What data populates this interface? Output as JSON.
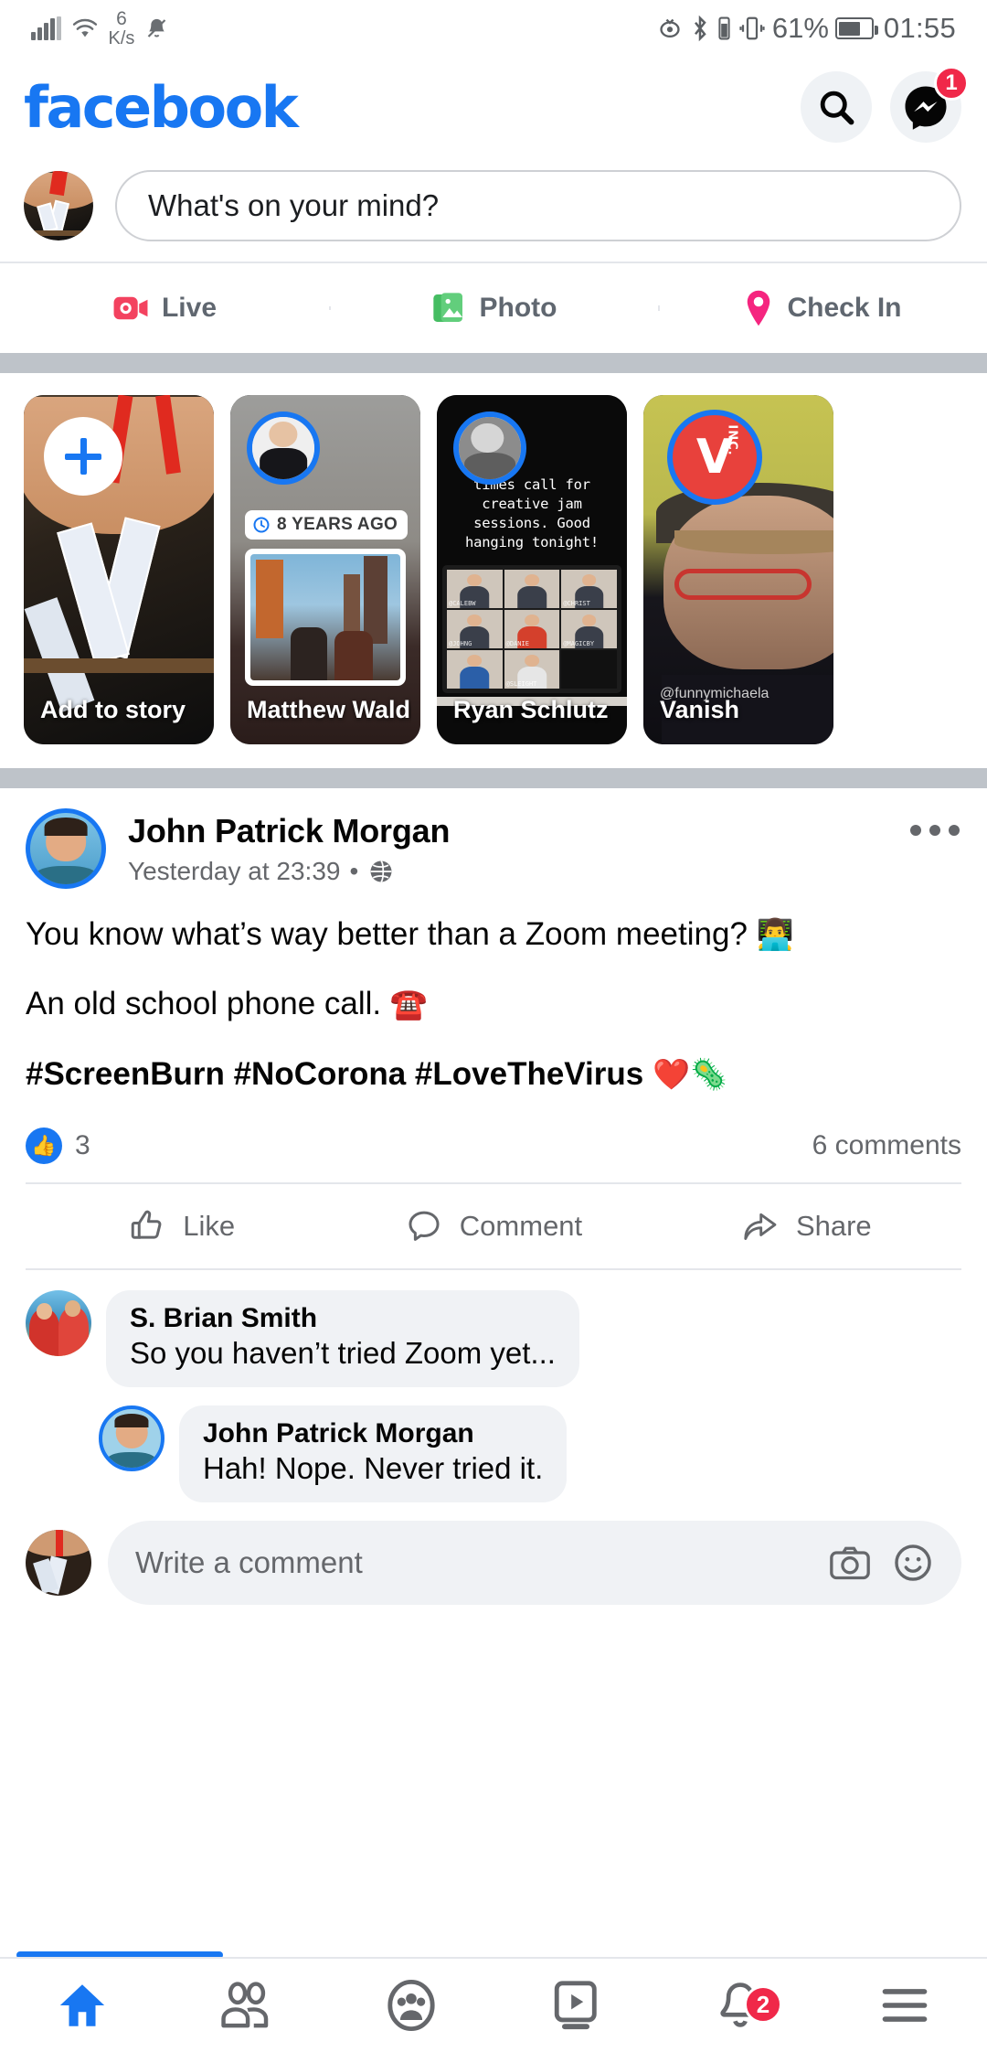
{
  "status_bar": {
    "network_speed_value": "6",
    "network_speed_unit": "K/s",
    "battery_percent": "61%",
    "time": "01:55",
    "icons": [
      "signal-bars-icon",
      "wifi-icon",
      "notification-silenced-icon",
      "eye-care-icon",
      "bluetooth-icon",
      "vibrate-icon",
      "battery-icon"
    ]
  },
  "header": {
    "logo_text": "facebook",
    "search_label": "Search",
    "messenger_label": "Messenger",
    "messenger_badge": "1"
  },
  "composer": {
    "placeholder": "What's on your mind?",
    "avatar_name": "user-avatar"
  },
  "composer_actions": [
    {
      "label": "Live",
      "color": "#F3425F",
      "icon": "live-video-icon"
    },
    {
      "label": "Photo",
      "color": "#45BD62",
      "icon": "photo-icon"
    },
    {
      "label": "Check In",
      "color": "#F5257F",
      "icon": "location-pin-icon"
    }
  ],
  "stories": [
    {
      "label": "Add to story",
      "kind": "add",
      "has_plus": true
    },
    {
      "label": "Matthew Waldman",
      "kind": "memory",
      "memory_badge": "8 YEARS AGO"
    },
    {
      "label": "Ryan Schlutz",
      "kind": "zoom",
      "overlay_text": "times call for creative jam sessions. Good hanging tonight!",
      "zoom_tags": [
        "@CALEBWILES",
        "@CHRISTIANMAGI",
        "@JOHNGMAGIC",
        "@DANIELLEFRANCES",
        "@MAGICBYSEBASTIAN",
        "@SLEIGHTBYJOSH"
      ]
    },
    {
      "label": "Vanish",
      "kind": "vanish",
      "logo_text": "V",
      "logo_sub": "INC.",
      "username": "@funnymichaela"
    }
  ],
  "post": {
    "author": "John Patrick Morgan",
    "timestamp": "Yesterday at 23:39",
    "separator": "•",
    "privacy_icon": "globe-icon",
    "menu_icon": "more-options-icon",
    "lines": [
      {
        "text": "You know what’s way better than a Zoom meeting?",
        "emoji": "👨‍💻",
        "bold": false
      },
      {
        "text": "An old school phone call.",
        "emoji": "☎️",
        "bold": false
      },
      {
        "text": "#ScreenBurn #NoCorona #LoveTheVirus",
        "emoji": "❤️🦠",
        "bold": true
      }
    ],
    "reaction_count": "3",
    "reaction_icon": "thumbs-up-icon",
    "comment_count": "6 comments",
    "actions": [
      {
        "label": "Like",
        "icon": "thumbs-up-outline-icon"
      },
      {
        "label": "Comment",
        "icon": "comment-bubble-icon"
      },
      {
        "label": "Share",
        "icon": "share-arrow-icon"
      }
    ]
  },
  "comments": [
    {
      "author": "S. Brian Smith",
      "text": "So you haven’t tried Zoom yet...",
      "is_reply": false,
      "avatar": "brian"
    },
    {
      "author": "John Patrick Morgan",
      "text": "Hah! Nope. Never tried it.",
      "is_reply": true,
      "avatar": "john"
    }
  ],
  "comment_composer": {
    "placeholder": "Write a comment",
    "camera_icon": "camera-icon",
    "emoji_icon": "emoji-smiley-icon"
  },
  "bottom_nav": [
    {
      "name": "home",
      "icon": "home-icon",
      "active": true,
      "badge": ""
    },
    {
      "name": "friends",
      "icon": "friends-icon",
      "active": false,
      "badge": ""
    },
    {
      "name": "groups",
      "icon": "groups-icon",
      "active": false,
      "badge": ""
    },
    {
      "name": "watch",
      "icon": "watch-video-icon",
      "active": false,
      "badge": ""
    },
    {
      "name": "notifications",
      "icon": "bell-icon",
      "active": false,
      "badge": "2"
    },
    {
      "name": "menu",
      "icon": "hamburger-menu-icon",
      "active": false,
      "badge": ""
    }
  ],
  "colors": {
    "brand_blue": "#1877F2",
    "badge_red": "#F02849",
    "bg_grey": "#BEC3C9",
    "bubble_grey": "#F0F2F5",
    "text_secondary": "#65676B"
  }
}
